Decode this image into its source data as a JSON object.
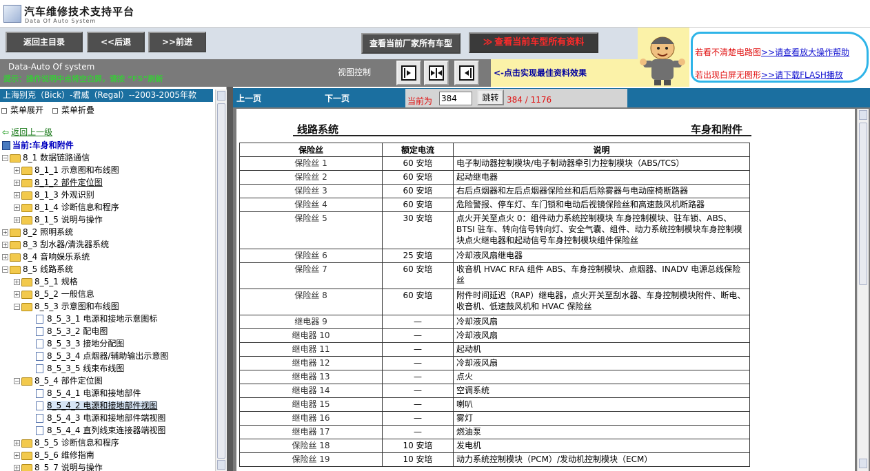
{
  "app": {
    "title": "汽车维修技术支持平台",
    "subtitle": "Data Of Auto System"
  },
  "toolbar": {
    "home": "返回主目录",
    "back": "<<后退",
    "forward": ">>前进",
    "all_maker_models": "查看当前厂家所有车型",
    "all_model_docs_arrows": "≫",
    "all_model_docs": "查看当前车型所有资料"
  },
  "help": {
    "line1_text": "若看不清楚电路图",
    "line1_link": ">>请查看放大操作帮助",
    "line2_text": "若出现白屏无图形",
    "line2_link": ">>请下载FLASH播放"
  },
  "status": {
    "system_name": "Data-Auto Of system",
    "hint": "提示：操作说明中点将空白屏，请按 “F5”刷新",
    "view_control": "视图控制",
    "view_tip": "<-点击实现最佳资料效果"
  },
  "tree": {
    "vehicle": "上海别克（Bick）-君威（Regal）--2003-2005年款",
    "expand": "菜单展开",
    "collapse": "菜单折叠",
    "back_up": "返回上一级",
    "current": "当前:车身和附件",
    "items": [
      {
        "label": "8_1 数据链路通信",
        "level": 0,
        "pm": "−",
        "type": "folder"
      },
      {
        "label": "8_1_1 示意图和布线图",
        "level": 1,
        "pm": "+",
        "type": "folder"
      },
      {
        "label": "8_1_2 部件定位图",
        "level": 1,
        "pm": "+",
        "type": "folder",
        "link": true
      },
      {
        "label": "8_1_3 外观识别",
        "level": 1,
        "pm": "+",
        "type": "folder"
      },
      {
        "label": "8_1_4 诊断信息和程序",
        "level": 1,
        "pm": "+",
        "type": "folder"
      },
      {
        "label": "8_1_5 说明与操作",
        "level": 1,
        "pm": "+",
        "type": "folder"
      },
      {
        "label": "8_2 照明系统",
        "level": 0,
        "pm": "+",
        "type": "folder"
      },
      {
        "label": "8_3 刮水器/清洗器系统",
        "level": 0,
        "pm": "+",
        "type": "folder"
      },
      {
        "label": "8_4 音响娱乐系统",
        "level": 0,
        "pm": "+",
        "type": "folder"
      },
      {
        "label": "8_5 线路系统",
        "level": 0,
        "pm": "−",
        "type": "folder"
      },
      {
        "label": "8_5_1 规格",
        "level": 1,
        "pm": "+",
        "type": "folder"
      },
      {
        "label": "8_5_2 一般信息",
        "level": 1,
        "pm": "+",
        "type": "folder"
      },
      {
        "label": "8_5_3 示意图和布线图",
        "level": 1,
        "pm": "−",
        "type": "folder"
      },
      {
        "label": "8_5_3_1 电源和接地示意图标",
        "level": 2,
        "type": "doc"
      },
      {
        "label": "8_5_3_2 配电图",
        "level": 2,
        "type": "doc"
      },
      {
        "label": "8_5_3_3 接地分配图",
        "level": 2,
        "type": "doc"
      },
      {
        "label": "8_5_3_4 点烟器/辅助输出示意图",
        "level": 2,
        "type": "doc"
      },
      {
        "label": "8_5_3_5 线束布线图",
        "level": 2,
        "type": "doc"
      },
      {
        "label": "8_5_4 部件定位图",
        "level": 1,
        "pm": "−",
        "type": "folder"
      },
      {
        "label": "8_5_4_1 电源和接地部件",
        "level": 2,
        "type": "doc"
      },
      {
        "label": "8_5_4_2 电源和接地部件视图",
        "level": 2,
        "type": "doc",
        "selected": true
      },
      {
        "label": "8_5_4_3 电源和接地部件端视图",
        "level": 2,
        "type": "doc"
      },
      {
        "label": "8_5_4_4 直列线束连接器端视图",
        "level": 2,
        "type": "doc"
      },
      {
        "label": "8_5_5 诊断信息和程序",
        "level": 1,
        "pm": "+",
        "type": "folder"
      },
      {
        "label": "8_5_6 维修指南",
        "level": 1,
        "pm": "+",
        "type": "folder"
      },
      {
        "label": "8_5_7 说明与操作",
        "level": 1,
        "pm": "+",
        "type": "folder"
      }
    ]
  },
  "pager": {
    "prev": "上一页",
    "next": "下一页",
    "current_label": "当前为",
    "current_value": "384",
    "jump": "跳转",
    "count": "384 / 1176"
  },
  "doc": {
    "section_left": "线路系统",
    "section_right": "车身和附件",
    "columns": [
      "保险丝",
      "额定电流",
      "说明"
    ],
    "rows": [
      [
        "保险丝 1",
        "60 安培",
        "电子制动器控制模块/电子制动器牵引力控制模块（ABS/TCS）"
      ],
      [
        "保险丝 2",
        "60 安培",
        "起动继电器"
      ],
      [
        "保险丝 3",
        "60 安培",
        "右后点烟器和左后点烟器保险丝和后后除雾器与电动座椅断路器"
      ],
      [
        "保险丝 4",
        "60 安培",
        "危险警报、停车灯、车门锁和电动后视镜保险丝和高速鼓风机断路器"
      ],
      [
        "保险丝 5",
        "30 安培",
        "点火开关至点火 0：组件动力系统控制模块 车身控制模块、驻车锁、ABS、BTSI 驻车、转向信号转向灯、安全气囊、组件、动力系统控制模块车身控制模块点火继电器和起动信号车身控制模块组件保险丝"
      ],
      [
        "保险丝 6",
        "25 安培",
        "冷却液风扇继电器"
      ],
      [
        "保险丝 7",
        "60 安培",
        "收音机 HVAC RFA 组件 ABS、车身控制模块、点烟器、INADV 电源总线保险丝"
      ],
      [
        "保险丝 8",
        "60 安培",
        "附件时间延迟（RAP）继电器，点火开关至刮水器、车身控制模块附件、断电、收音机、低速鼓风机和 HVAC 保险丝"
      ],
      [
        "继电器 9",
        "—",
        "冷却液风扇"
      ],
      [
        "继电器 10",
        "—",
        "冷却液风扇"
      ],
      [
        "继电器 11",
        "—",
        "起动机"
      ],
      [
        "继电器 12",
        "—",
        "冷却液风扇"
      ],
      [
        "继电器 13",
        "—",
        "点火"
      ],
      [
        "继电器 14",
        "—",
        "空调系统"
      ],
      [
        "继电器 15",
        "—",
        "喇叭"
      ],
      [
        "继电器 16",
        "—",
        "雾灯"
      ],
      [
        "继电器 17",
        "—",
        "燃油泵"
      ],
      [
        "保险丝 18",
        "10 安培",
        "发电机"
      ],
      [
        "保险丝 19",
        "10 安培",
        "动力系统控制模块（PCM）/发动机控制模块（ECM）"
      ]
    ]
  }
}
